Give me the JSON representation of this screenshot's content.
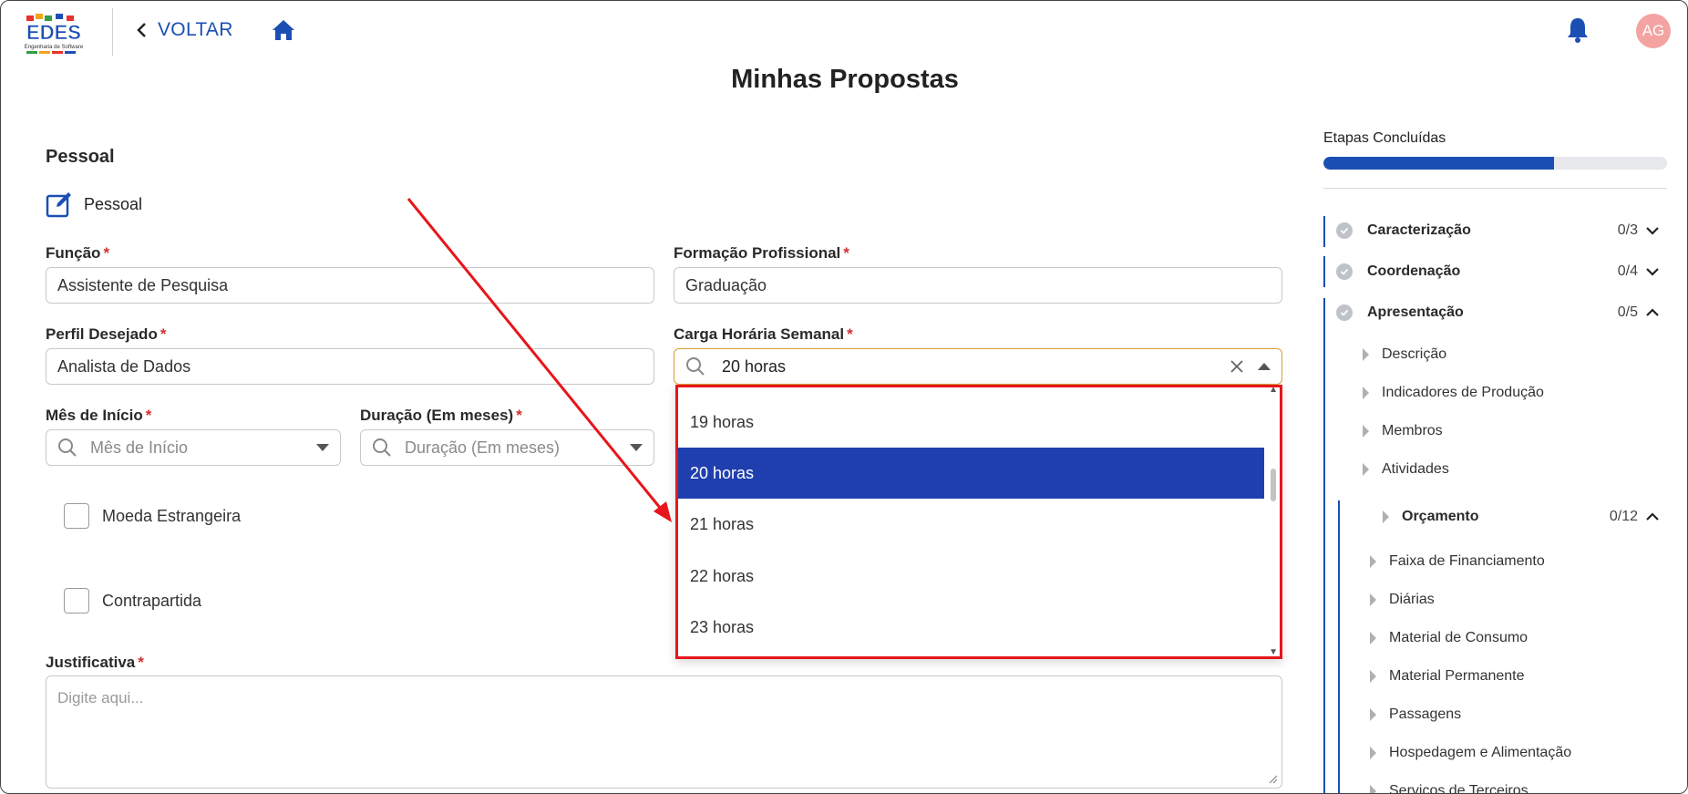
{
  "header": {
    "back_label": "VOLTAR",
    "avatar_initials": "AG",
    "page_title": "Minhas Propostas"
  },
  "form": {
    "section_title": "Pessoal",
    "edit_label": "Pessoal",
    "funcao": {
      "label": "Função",
      "value": "Assistente de Pesquisa"
    },
    "formacao": {
      "label": "Formação Profissional",
      "value": "Graduação"
    },
    "perfil": {
      "label": "Perfil Desejado",
      "value": "Analista de Dados"
    },
    "carga": {
      "label": "Carga Horária Semanal",
      "value": "20 horas"
    },
    "mes_inicio": {
      "label": "Mês de Início",
      "placeholder": "Mês de Início"
    },
    "duracao": {
      "label": "Duração (Em meses)",
      "placeholder": "Duração (Em meses)"
    },
    "moeda_label": "Moeda Estrangeira",
    "contrapartida_label": "Contrapartida",
    "justificativa": {
      "label": "Justificativa",
      "placeholder": "Digite aqui..."
    }
  },
  "dropdown": {
    "options": [
      "19 horas",
      "20 horas",
      "21 horas",
      "22 horas",
      "23 horas"
    ],
    "selected": "20 horas"
  },
  "progress": {
    "title": "Etapas Concluídas",
    "fraction": 0.67
  },
  "steps": [
    {
      "name": "Caracterização",
      "count": "0/3",
      "expanded": false
    },
    {
      "name": "Coordenação",
      "count": "0/4",
      "expanded": false
    },
    {
      "name": "Apresentação",
      "count": "0/5",
      "expanded": true
    }
  ],
  "apresentacao_items": [
    "Descrição",
    "Indicadores de Produção",
    "Membros",
    "Atividades"
  ],
  "orcamento": {
    "name": "Orçamento",
    "count": "0/12",
    "items": [
      "Faixa de Financiamento",
      "Diárias",
      "Material de Consumo",
      "Material Permanente",
      "Passagens",
      "Hospedagem e Alimentação",
      "Serviços de Terceiros"
    ]
  },
  "colors": {
    "primary": "#1b4fb3",
    "selected_option": "#1f3fae",
    "highlight": "#e8151b",
    "required": "#d32f2f",
    "avatar": "#f4a3a3"
  }
}
